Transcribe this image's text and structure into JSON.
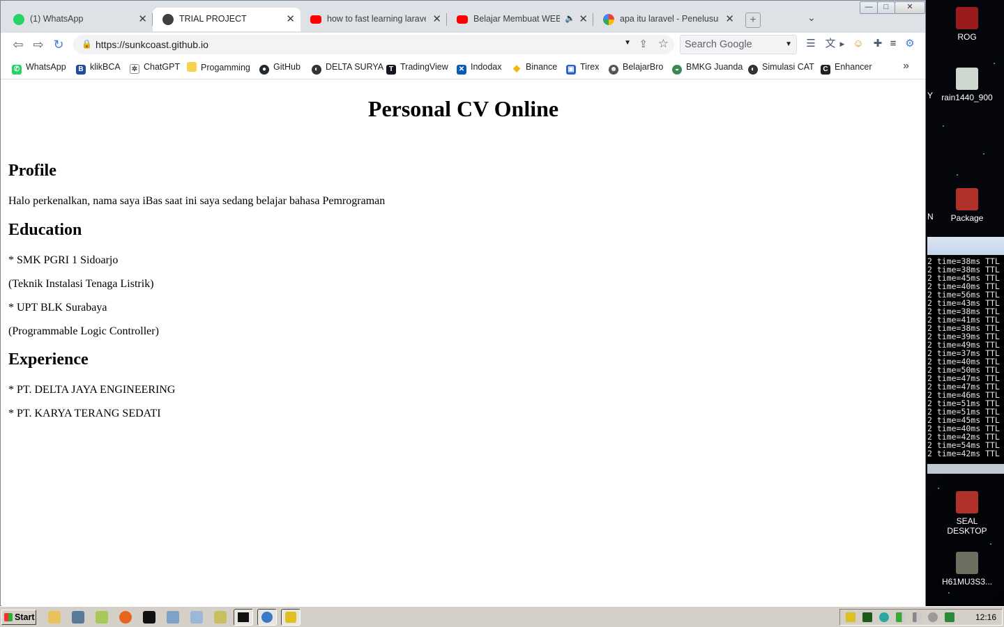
{
  "browser": {
    "tabs": [
      {
        "label": "(1) WhatsApp",
        "favicon_color": "#25d366",
        "active": false
      },
      {
        "label": "TRIAL PROJECT",
        "favicon_color": "#3c4043",
        "active": true
      },
      {
        "label": "how to fast learning laravel -",
        "favicon_color": "#ff0000",
        "active": false
      },
      {
        "label": "Belajar Membuat WEBSIT",
        "favicon_color": "#ff0000",
        "active": false
      },
      {
        "label": "apa itu laravel - Penelusuran",
        "favicon_color": "#4285f4",
        "active": false
      }
    ],
    "new_tab_symbol": "+",
    "tab_list_symbol": "⌄",
    "window_controls": {
      "minimize": "—",
      "maximize": "□",
      "close": "✕"
    },
    "nav": {
      "back": "⇦",
      "forward": "⇨",
      "reload": "↻"
    },
    "address": {
      "url": "https://sunkcoast.github.io",
      "lock": "🔒"
    },
    "search": {
      "placeholder": "Search Google"
    },
    "extensions": [
      "reader-icon",
      "translate-icon",
      "people-icon",
      "puzzle-icon",
      "playlist-icon",
      "settings-icon"
    ],
    "bookmarks": [
      {
        "label": "WhatsApp",
        "color": "#25d366",
        "glyph": "✆"
      },
      {
        "label": "klikBCA",
        "color": "#1d4f9c",
        "glyph": "B"
      },
      {
        "label": "ChatGPT",
        "color": "#444444",
        "glyph": "✲"
      },
      {
        "label": "Progamming",
        "color": "#f6d34b",
        "glyph": ""
      },
      {
        "label": "GitHub",
        "color": "#24292e",
        "glyph": "●"
      },
      {
        "label": "DELTA SURYA",
        "color": "#333333",
        "glyph": "◐"
      },
      {
        "label": "TradingView",
        "color": "#131722",
        "glyph": "T"
      },
      {
        "label": "Indodax",
        "color": "#0b5ab8",
        "glyph": "✕"
      },
      {
        "label": "Binance",
        "color": "#f0b90b",
        "glyph": "◆"
      },
      {
        "label": "Tirex",
        "color": "#2a62c8",
        "glyph": "▣"
      },
      {
        "label": "BelajarBro",
        "color": "#555555",
        "glyph": "☻"
      },
      {
        "label": "BMKG Juanda",
        "color": "#3a8a55",
        "glyph": "◒"
      },
      {
        "label": "Simulasi CAT",
        "color": "#333333",
        "glyph": "◐"
      },
      {
        "label": "Enhancer",
        "color": "#222222",
        "glyph": "C"
      }
    ],
    "bookmarks_more": "»"
  },
  "page": {
    "title": "Personal CV Online",
    "sections": {
      "profile_heading": "Profile",
      "profile_text": "Halo perkenalkan, nama saya iBas saat ini saya sedang belajar bahasa Pemrograman",
      "education_heading": "Education",
      "education_items": [
        "* SMK PGRI 1 Sidoarjo",
        "(Teknik Instalasi Tenaga Listrik)",
        "* UPT BLK Surabaya",
        "(Programmable Logic Controller)"
      ],
      "experience_heading": "Experience",
      "experience_items": [
        "* PT. DELTA JAYA ENGINEERING",
        "* PT. KARYA TERANG SEDATI"
      ]
    }
  },
  "desktop": {
    "icons": [
      {
        "label": "ROG",
        "color": "#9a1b1b"
      },
      {
        "label": "rain1440_900",
        "color": "#cfd8cf"
      },
      {
        "label": "Package",
        "color": "#b0302a"
      },
      {
        "label": "SEAL DESKTOP",
        "color": "#b0302a"
      },
      {
        "label": "H61MU3S3...",
        "color": "#6b7060"
      }
    ],
    "clipped_labels": [
      "Y",
      "N"
    ],
    "terminal_lines": [
      "2 time=38ms TTL",
      "2 time=38ms TTL",
      "2 time=45ms TTL",
      "2 time=40ms TTL",
      "2 time=56ms TTL",
      "2 time=43ms TTL",
      "2 time=38ms TTL",
      "2 time=41ms TTL",
      "2 time=38ms TTL",
      "2 time=39ms TTL",
      "2 time=49ms TTL",
      "2 time=37ms TTL",
      "2 time=40ms TTL",
      "2 time=50ms TTL",
      "2 time=47ms TTL",
      "2 time=47ms TTL",
      "2 time=46ms TTL",
      "2 time=51ms TTL",
      "2 time=51ms TTL",
      "2 time=45ms TTL",
      "2 time=40ms TTL",
      "2 time=42ms TTL",
      "2 time=54ms TTL",
      "2 time=42ms TTL"
    ]
  },
  "taskbar": {
    "start_label": "Start",
    "quick_launch": [
      {
        "name": "folder-icon",
        "color": "#e8c25a"
      },
      {
        "name": "computer-icon",
        "color": "#5a7a9a"
      },
      {
        "name": "files-icon",
        "color": "#a8c85a"
      },
      {
        "name": "firefox-icon",
        "color": "#e8641b"
      },
      {
        "name": "cmd-icon",
        "color": "#111111"
      },
      {
        "name": "calculator-icon",
        "color": "#7fa0c8"
      },
      {
        "name": "document-icon",
        "color": "#9ab8d8"
      },
      {
        "name": "notepad-icon",
        "color": "#c8c060"
      }
    ],
    "open_windows": [
      {
        "name": "cmd-window-icon",
        "color": "#111111"
      },
      {
        "name": "browser-window-icon",
        "color": "#3a78c8"
      },
      {
        "name": "app-window-icon",
        "color": "#e0c020"
      }
    ],
    "clock": "12:16"
  }
}
